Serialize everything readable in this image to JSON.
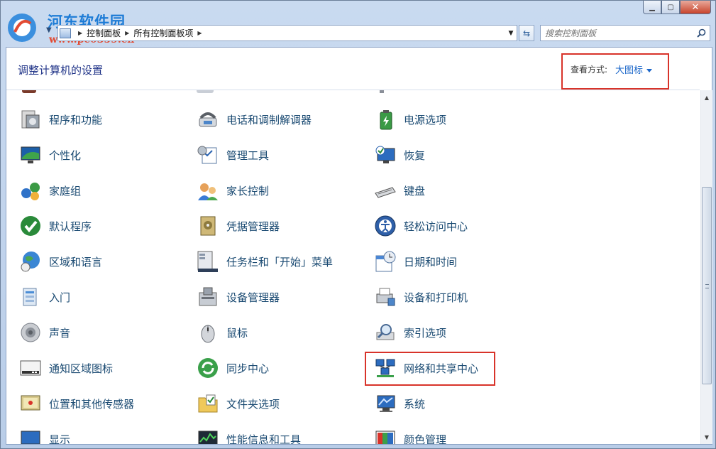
{
  "watermark": {
    "title": "河东软件园",
    "url": "www.pc0359.cn"
  },
  "window": {
    "minimize_icon": "minimize-icon",
    "maximize_icon": "maximize-icon",
    "close_icon": "close-icon"
  },
  "address": {
    "crumbs": [
      "控制面板",
      "所有控制面板项"
    ],
    "icon": "control-panel-icon"
  },
  "search": {
    "placeholder": "搜索控制面板",
    "icon": "search-icon"
  },
  "header": {
    "title": "调整计算机的设置",
    "view_by_label": "查看方式:",
    "view_by_value": "大图标"
  },
  "items": {
    "col1": [
      "程序和功能",
      "个性化",
      "家庭组",
      "默认程序",
      "区域和语言",
      "入门",
      "声音",
      "通知区域图标",
      "位置和其他传感器",
      "显示"
    ],
    "col2": [
      "电话和调制解调器",
      "管理工具",
      "家长控制",
      "凭据管理器",
      "任务栏和「开始」菜单",
      "设备管理器",
      "鼠标",
      "同步中心",
      "文件夹选项",
      "性能信息和工具"
    ],
    "col3": [
      "电源选项",
      "恢复",
      "键盘",
      "轻松访问中心",
      "日期和时间",
      "设备和打印机",
      "索引选项",
      "网络和共享中心",
      "系统",
      "颜色管理"
    ]
  },
  "colors": {
    "link": "#1a4a72",
    "heading": "#1e3287",
    "highlight": "#d8332a",
    "accent": "#1a66c9"
  }
}
